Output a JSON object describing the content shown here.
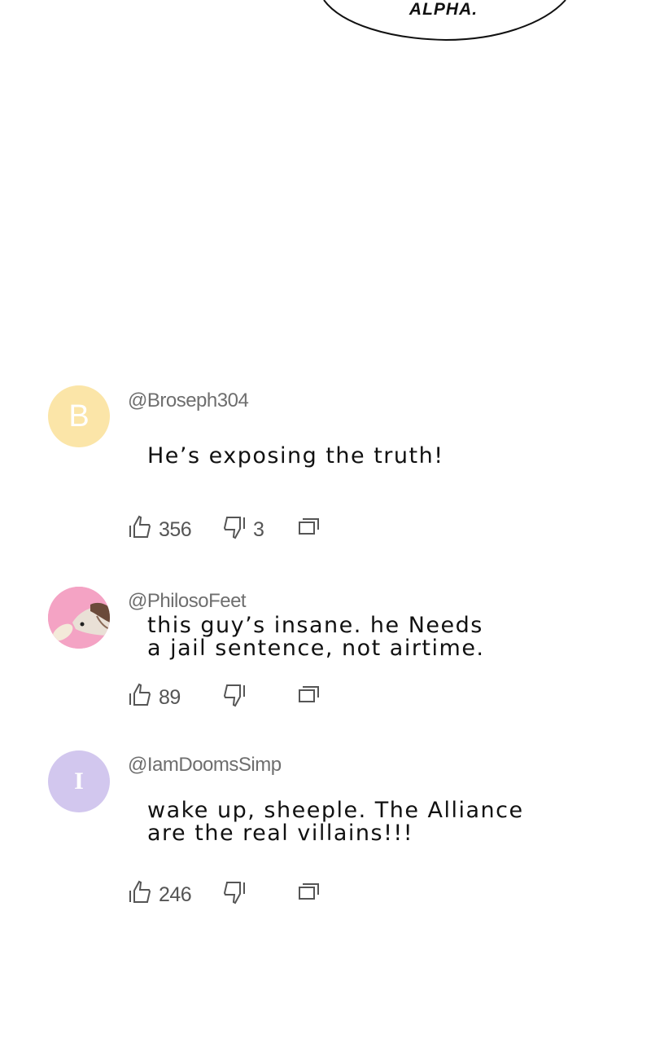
{
  "speech_bubble": {
    "text": "ALPHA."
  },
  "comments": [
    {
      "username": "@Broseph304",
      "avatar": {
        "type": "letter",
        "letter": "B",
        "color": "#fbe5a8"
      },
      "text": "He’s exposing the truth!",
      "likes": "356",
      "dislikes": "3"
    },
    {
      "username": "@PhilosoFeet",
      "avatar": {
        "type": "photo",
        "color": "#f4a3c4"
      },
      "text": "this guy’s insane. he Needs\na jail sentence, not airtime.",
      "likes": "89",
      "dislikes": ""
    },
    {
      "username": "@IamDoomsSimp",
      "avatar": {
        "type": "letter",
        "letter": "I",
        "color": "#d2c7ee"
      },
      "text": "wake up, sheeple. The Alliance\nare the real villains!!!",
      "likes": "246",
      "dislikes": ""
    }
  ],
  "icons": {
    "like": "thumbs-up-icon",
    "dislike": "thumbs-down-icon",
    "reply": "reply-icon"
  }
}
